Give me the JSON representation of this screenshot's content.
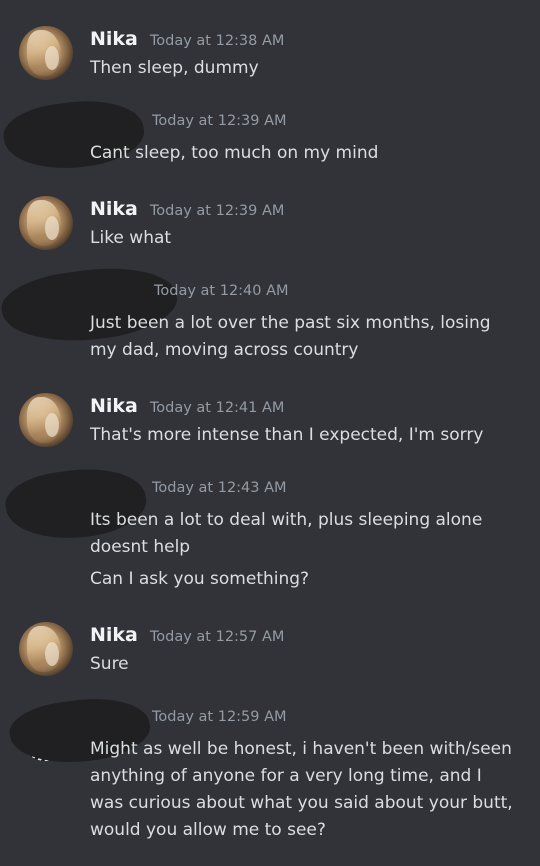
{
  "colors": {
    "background": "#313338",
    "username": "#f2f3f5",
    "timestamp": "#949ba4",
    "message_text": "#dbdee1"
  },
  "messages": [
    {
      "author": "Nika",
      "avatar_icon": "user-avatar-icon",
      "timestamp": "Today at 12:38 AM",
      "lines": [
        "Then sleep, dummy"
      ]
    },
    {
      "author": "",
      "avatar_icon": "user-avatar-icon",
      "timestamp": "Today at 12:39 AM",
      "lines": [
        "Cant sleep, too much on my mind"
      ]
    },
    {
      "author": "Nika",
      "avatar_icon": "user-avatar-icon",
      "timestamp": "Today at 12:39 AM",
      "lines": [
        "Like what"
      ]
    },
    {
      "author": "",
      "avatar_icon": "user-avatar-icon",
      "timestamp": "Today at 12:40 AM",
      "lines": [
        "Just been a lot over the past six months, losing my dad, moving across country"
      ]
    },
    {
      "author": "Nika",
      "avatar_icon": "user-avatar-icon",
      "timestamp": "Today at 12:41 AM",
      "lines": [
        "That's more intense than I expected,  I'm sorry"
      ]
    },
    {
      "author": "",
      "avatar_icon": "user-avatar-icon",
      "timestamp": "Today at 12:43 AM",
      "lines": [
        "Its been a lot to deal with, plus sleeping alone doesnt help",
        "Can I ask you something?"
      ]
    },
    {
      "author": "Nika",
      "avatar_icon": "user-avatar-icon",
      "timestamp": "Today at 12:57 AM",
      "lines": [
        "Sure"
      ]
    },
    {
      "author": "",
      "avatar_icon": "user-avatar-icon",
      "timestamp": "Today at 12:59 AM",
      "lines": [
        "Might as well be honest, i haven't been with/seen anything of anyone for a very long time, and I was curious about what you said about your butt, would you allow me to see?"
      ]
    }
  ]
}
